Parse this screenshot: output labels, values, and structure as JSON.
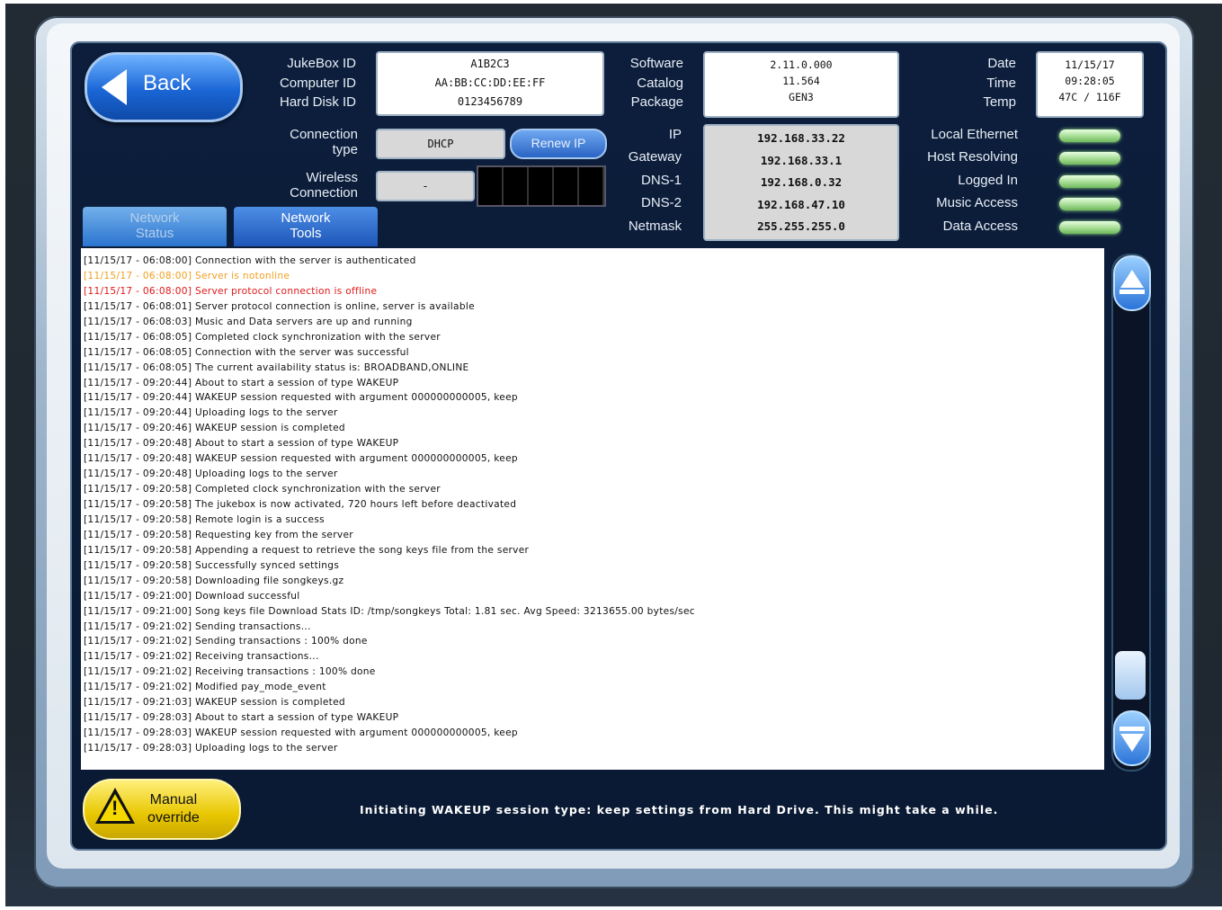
{
  "header": {
    "back_label": "Back",
    "jukebox_id_label": "JukeBox ID",
    "computer_id_label": "Computer ID",
    "hard_disk_id_label": "Hard Disk ID",
    "jukebox_id_value": "A1B2C3",
    "computer_id_value": "AA:BB:CC:DD:EE:FF",
    "hard_disk_id_value": "0123456789",
    "software_label": "Software",
    "catalog_label": "Catalog",
    "package_label": "Package",
    "software_value": "2.11.0.000",
    "catalog_value": "11.564",
    "package_value": "GEN3",
    "date_label": "Date",
    "time_label": "Time",
    "temp_label": "Temp",
    "date_value": "11/15/17",
    "time_value": "09:28:05",
    "temp_value": "47C / 116F"
  },
  "connection": {
    "connection_type_label_line1": "Connection",
    "connection_type_label_line2": "type",
    "connection_type_value": "DHCP",
    "renew_ip_label": "Renew IP",
    "wireless_label_line1": "Wireless",
    "wireless_label_line2": "Connection",
    "wireless_value": "-"
  },
  "network": {
    "ip_label": "IP",
    "gateway_label": "Gateway",
    "dns1_label": "DNS-1",
    "dns2_label": "DNS-2",
    "netmask_label": "Netmask",
    "ip_value": "192.168.33.22",
    "gateway_value": "192.168.33.1",
    "dns1_value": "192.168.0.32",
    "dns2_value": "192.168.47.10",
    "netmask_value": "255.255.255.0"
  },
  "status": {
    "local_ethernet": "Local Ethernet",
    "host_resolving": "Host Resolving",
    "logged_in": "Logged In",
    "music_access": "Music Access",
    "data_access": "Data Access"
  },
  "tabs": {
    "network_status_line1": "Network",
    "network_status_line2": "Status",
    "network_tools_line1": "Network",
    "network_tools_line2": "Tools"
  },
  "log_lines": [
    {
      "text": "[11/15/17 - 06:08:00] Connection with the server is authenticated",
      "color": "#111111"
    },
    {
      "text": "[11/15/17 - 06:08:00] Server is notonline",
      "color": "#f0a020"
    },
    {
      "text": "[11/15/17 - 06:08:00] Server protocol connection is offline",
      "color": "#e01818"
    },
    {
      "text": "[11/15/17 - 06:08:01] Server protocol connection is online, server is available",
      "color": "#111111"
    },
    {
      "text": "[11/15/17 - 06:08:03] Music and Data servers are up and running",
      "color": "#111111"
    },
    {
      "text": "[11/15/17 - 06:08:05] Completed clock synchronization with the server",
      "color": "#111111"
    },
    {
      "text": "[11/15/17 - 06:08:05] Connection with the server was successful",
      "color": "#111111"
    },
    {
      "text": "[11/15/17 - 06:08:05] The current availability status is: BROADBAND,ONLINE",
      "color": "#111111"
    },
    {
      "text": "[11/15/17 - 09:20:44] About to start a session of type WAKEUP",
      "color": "#111111"
    },
    {
      "text": "[11/15/17 - 09:20:44] WAKEUP session requested with argument 000000000005, keep",
      "color": "#111111"
    },
    {
      "text": "[11/15/17 - 09:20:44] Uploading logs to the server",
      "color": "#111111"
    },
    {
      "text": "[11/15/17 - 09:20:46] WAKEUP session is completed",
      "color": "#111111"
    },
    {
      "text": "[11/15/17 - 09:20:48] About to start a session of type WAKEUP",
      "color": "#111111"
    },
    {
      "text": "[11/15/17 - 09:20:48] WAKEUP session requested with argument 000000000005, keep",
      "color": "#111111"
    },
    {
      "text": "[11/15/17 - 09:20:48] Uploading logs to the server",
      "color": "#111111"
    },
    {
      "text": "[11/15/17 - 09:20:58] Completed clock synchronization with the server",
      "color": "#111111"
    },
    {
      "text": "[11/15/17 - 09:20:58] The jukebox is now activated, 720 hours left before deactivated",
      "color": "#111111"
    },
    {
      "text": "[11/15/17 - 09:20:58] Remote login is a success",
      "color": "#111111"
    },
    {
      "text": "[11/15/17 - 09:20:58] Requesting key from the server",
      "color": "#111111"
    },
    {
      "text": "[11/15/17 - 09:20:58] Appending a request to retrieve the song keys file from the server",
      "color": "#111111"
    },
    {
      "text": "[11/15/17 - 09:20:58] Successfully synced settings",
      "color": "#111111"
    },
    {
      "text": "[11/15/17 - 09:20:58] Downloading file songkeys.gz",
      "color": "#111111"
    },
    {
      "text": "[11/15/17 - 09:21:00] Download successful",
      "color": "#111111"
    },
    {
      "text": "[11/15/17 - 09:21:00] Song keys file Download Stats ID: /tmp/songkeys Total: 1.81 sec. Avg Speed: 3213655.00 bytes/sec",
      "color": "#111111"
    },
    {
      "text": "[11/15/17 - 09:21:02] Sending transactions...",
      "color": "#111111"
    },
    {
      "text": "[11/15/17 - 09:21:02] Sending transactions : 100% done",
      "color": "#111111"
    },
    {
      "text": "[11/15/17 - 09:21:02] Receiving transactions...",
      "color": "#111111"
    },
    {
      "text": "[11/15/17 - 09:21:02] Receiving transactions : 100% done",
      "color": "#111111"
    },
    {
      "text": "[11/15/17 - 09:21:02] Modified pay_mode_event",
      "color": "#111111"
    },
    {
      "text": "[11/15/17 - 09:21:03] WAKEUP session is completed",
      "color": "#111111"
    },
    {
      "text": "[11/15/17 - 09:28:03] About to start a session of type WAKEUP",
      "color": "#111111"
    },
    {
      "text": "[11/15/17 - 09:28:03] WAKEUP session requested with argument 000000000005, keep",
      "color": "#111111"
    },
    {
      "text": "[11/15/17 - 09:28:03] Uploading logs to the server",
      "color": "#111111"
    }
  ],
  "footer": {
    "manual_override_line1": "Manual",
    "manual_override_line2": "override",
    "status_message": "Initiating WAKEUP session type: keep settings from Hard Drive. This might take a while."
  },
  "icons": {
    "back": "left-arrow-icon",
    "warning": "warning-triangle-icon",
    "scroll_up": "up-arrow-icon",
    "scroll_down": "down-arrow-icon"
  }
}
